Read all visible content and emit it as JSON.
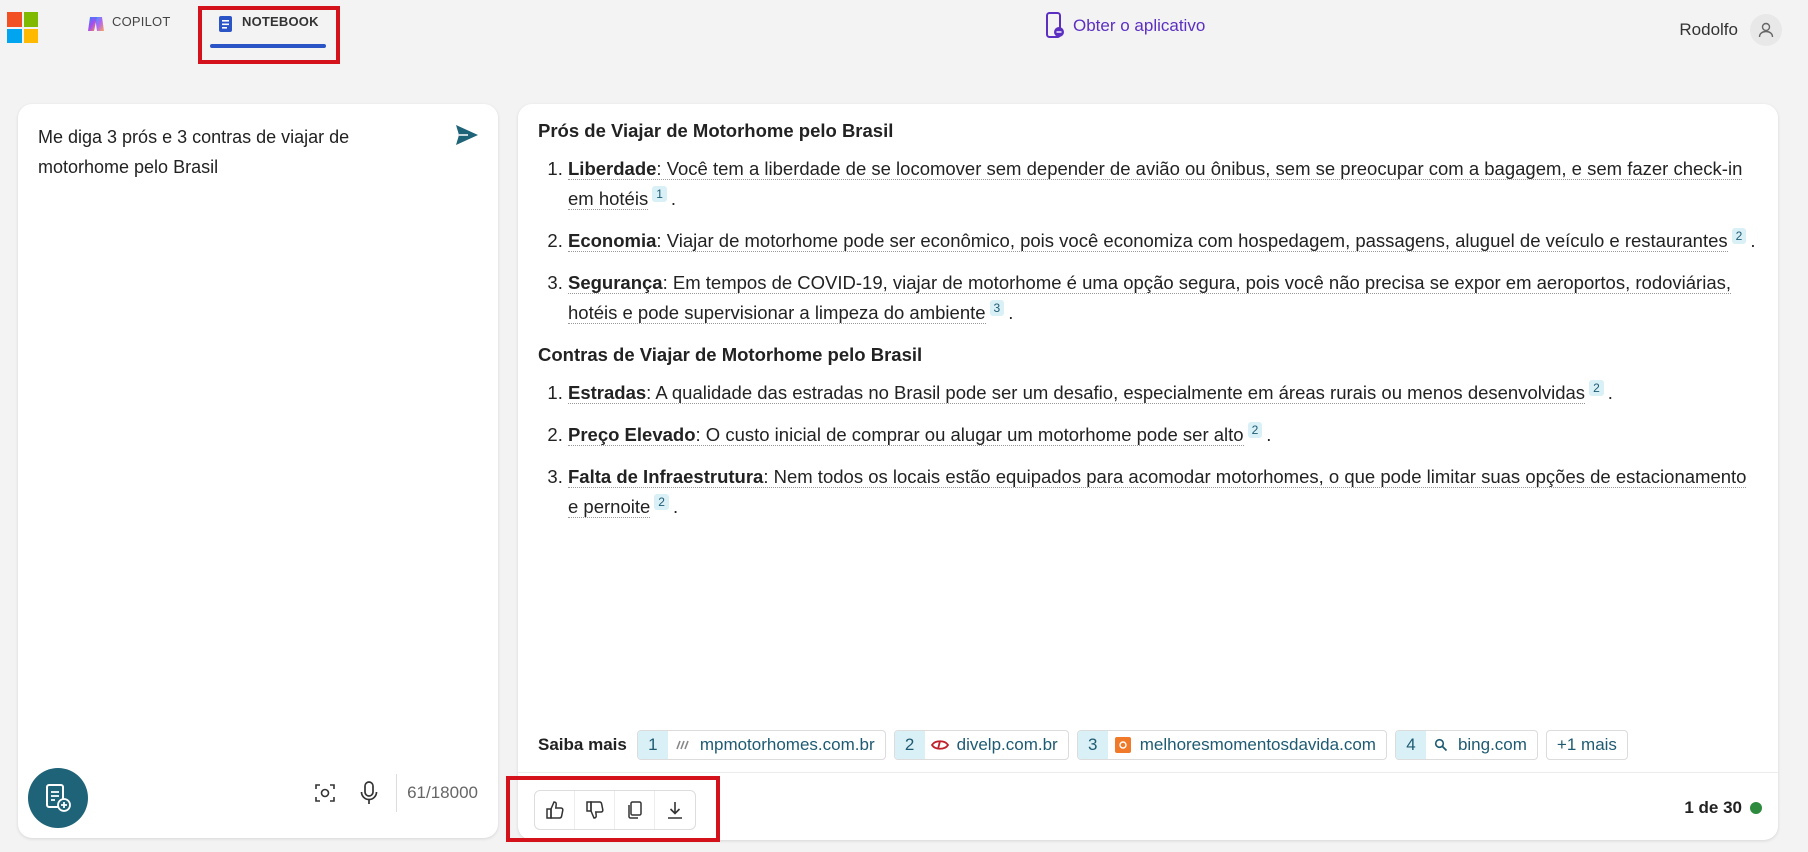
{
  "header": {
    "tabs": [
      {
        "label": "COPILOT"
      },
      {
        "label": "NOTEBOOK"
      }
    ],
    "get_app": "Obter o aplicativo",
    "user_name": "Rodolfo"
  },
  "left": {
    "prompt": "Me diga 3 prós e 3 contras de viajar de motorhome pelo Brasil",
    "char_count": "61/18000"
  },
  "answer": {
    "pros_title": "Prós de Viajar de Motorhome pelo Brasil",
    "pros": [
      {
        "term": "Liberdade",
        "text": ": Você tem a liberdade de se locomover sem depender de avião ou ônibus, sem se preocupar com a bagagem, e sem fazer check-in em hotéis",
        "cite": "1"
      },
      {
        "term": "Economia",
        "text": ": Viajar de motorhome pode ser econômico, pois você economiza com hospedagem, passagens, aluguel de veículo e restaurantes",
        "cite": "2"
      },
      {
        "term": "Segurança",
        "text": ": Em tempos de COVID-19, viajar de motorhome é uma opção segura, pois você não precisa se expor em aeroportos, rodoviárias, hotéis e pode supervisionar a limpeza do ambiente",
        "cite": "3"
      }
    ],
    "cons_title": "Contras de Viajar de Motorhome pelo Brasil",
    "cons": [
      {
        "term": "Estradas",
        "text": ": A qualidade das estradas no Brasil pode ser um desafio, especialmente em áreas rurais ou menos desenvolvidas",
        "cite": "2"
      },
      {
        "term": "Preço Elevado",
        "text": ": O custo inicial de comprar ou alugar um motorhome pode ser alto",
        "cite": "2"
      },
      {
        "term": "Falta de Infraestrutura",
        "text": ": Nem todos os locais estão equipados para acomodar motorhomes, o que pode limitar suas opções de estacionamento e pernoite",
        "cite": "2"
      }
    ],
    "period": "."
  },
  "learn_more": {
    "label": "Saiba mais",
    "sources": [
      {
        "num": "1",
        "domain": "mpmotorhomes.com.br",
        "icon": "mp-favicon"
      },
      {
        "num": "2",
        "domain": "divelp.com.br",
        "icon": "divelp-favicon"
      },
      {
        "num": "3",
        "domain": "melhoresmomentosdavida.com",
        "icon": "mmv-favicon"
      },
      {
        "num": "4",
        "domain": "bing.com",
        "icon": "search-icon"
      }
    ],
    "more": "+1 mais"
  },
  "footer": {
    "page": "1 de 30",
    "status_color": "#2e8b3e"
  },
  "colors": {
    "accent": "#1e6378",
    "tab_underline": "#2b55c6",
    "highlight_box": "#d4121c",
    "get_app": "#5b2fc2"
  }
}
